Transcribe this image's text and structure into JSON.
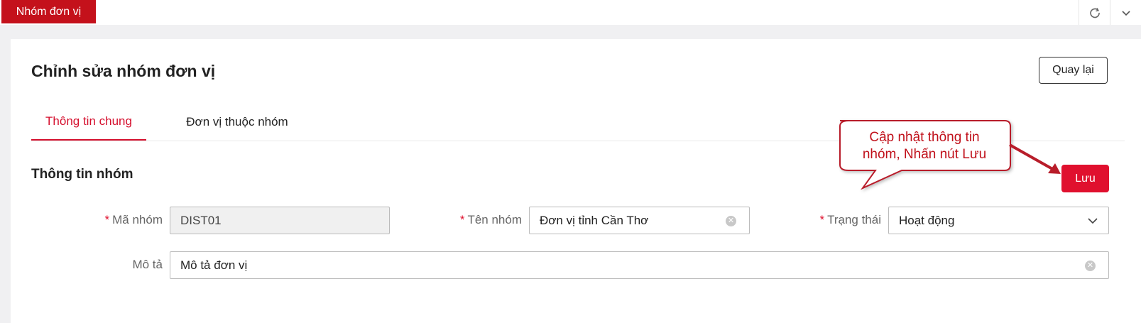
{
  "top_tab": {
    "label": "Nhóm đơn vị"
  },
  "top_icons": {
    "refresh": "refresh-icon",
    "collapse": "chevron-down-icon"
  },
  "page": {
    "title": "Chỉnh sửa nhóm đơn vị",
    "back_label": "Quay lại"
  },
  "tabs": [
    {
      "label": "Thông tin chung",
      "active": true
    },
    {
      "label": "Đơn vị thuộc nhóm",
      "active": false
    }
  ],
  "section": {
    "title": "Thông tin nhóm",
    "save_label": "Lưu"
  },
  "form": {
    "required_mark": "*",
    "code": {
      "label": "Mã nhóm",
      "value": "DIST01"
    },
    "name": {
      "label": "Tên nhóm",
      "value": "Đơn vị tỉnh Cần Thơ"
    },
    "status": {
      "label": "Trạng thái",
      "value": "Hoạt động"
    },
    "description": {
      "label": "Mô tả",
      "value": "Mô tả đơn vị"
    }
  },
  "annotation": {
    "line1": "Cập nhật thông tin",
    "line2": "nhóm, Nhấn nút Lưu"
  },
  "colors": {
    "brand_red": "#c4111b",
    "accent_red": "#e0102e",
    "callout_text": "#c0101a"
  }
}
